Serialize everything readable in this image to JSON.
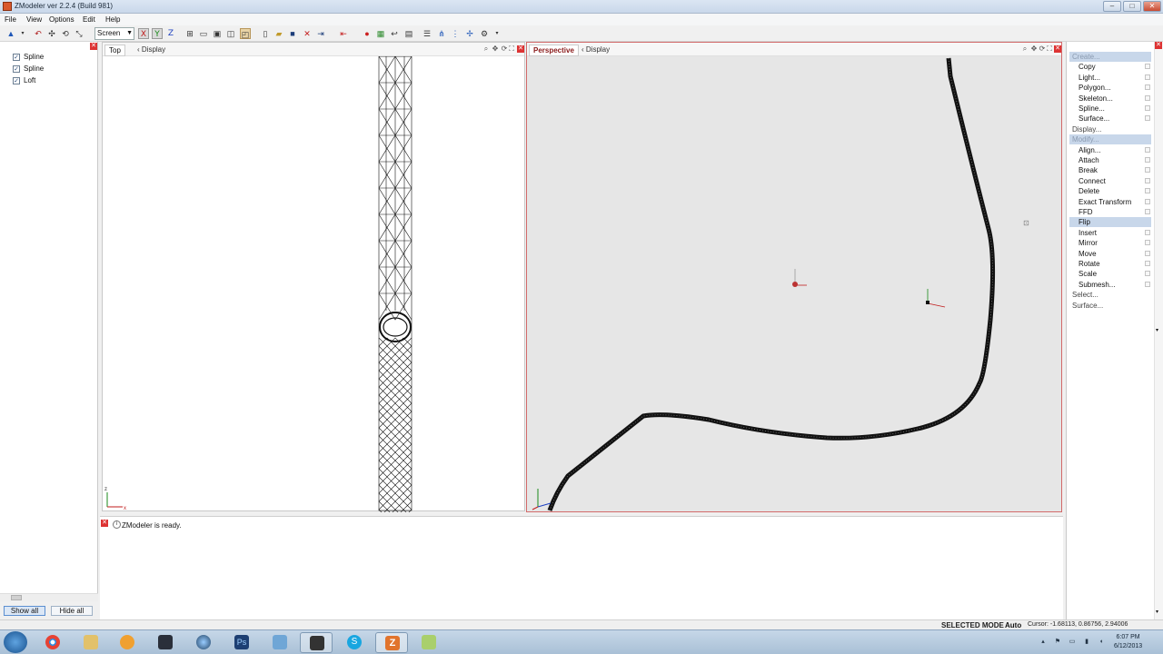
{
  "window": {
    "title": "ZModeler ver 2.2.4 (Build 981)"
  },
  "menu": [
    "File",
    "View",
    "Options",
    "Edit",
    "Help"
  ],
  "toolbar": {
    "view_mode": "Screen",
    "axes": [
      "X",
      "Y",
      "Z"
    ]
  },
  "tree": {
    "items": [
      {
        "label": "Spline",
        "checked": true
      },
      {
        "label": "Spline",
        "checked": true
      },
      {
        "label": "Loft",
        "checked": true
      }
    ],
    "show_all": "Show all",
    "hide_all": "Hide all"
  },
  "viewports": {
    "top": {
      "name": "Top",
      "display": "Display"
    },
    "perspective": {
      "name": "Perspective",
      "display": "Display"
    }
  },
  "log": {
    "message": "ZModeler is ready."
  },
  "commands": [
    {
      "label": "Create...",
      "kind": "category",
      "highlight": true,
      "disabled": true
    },
    {
      "label": "Copy",
      "kind": "item"
    },
    {
      "label": "Light...",
      "kind": "item"
    },
    {
      "label": "Polygon...",
      "kind": "item"
    },
    {
      "label": "Skeleton...",
      "kind": "item"
    },
    {
      "label": "Spline...",
      "kind": "item"
    },
    {
      "label": "Surface...",
      "kind": "item"
    },
    {
      "label": "Display...",
      "kind": "category"
    },
    {
      "label": "Modify...",
      "kind": "category",
      "highlight": true,
      "disabled": true
    },
    {
      "label": "Align...",
      "kind": "item"
    },
    {
      "label": "Attach",
      "kind": "item"
    },
    {
      "label": "Break",
      "kind": "item"
    },
    {
      "label": "Connect",
      "kind": "item"
    },
    {
      "label": "Delete",
      "kind": "item"
    },
    {
      "label": "Exact Transform",
      "kind": "item"
    },
    {
      "label": "FFD",
      "kind": "item"
    },
    {
      "label": "Flip",
      "kind": "item",
      "highlight": true
    },
    {
      "label": "Insert",
      "kind": "item"
    },
    {
      "label": "Mirror",
      "kind": "item"
    },
    {
      "label": "Move",
      "kind": "item"
    },
    {
      "label": "Rotate",
      "kind": "item"
    },
    {
      "label": "Scale",
      "kind": "item"
    },
    {
      "label": "Submesh...",
      "kind": "item"
    },
    {
      "label": "Select...",
      "kind": "category"
    },
    {
      "label": "Surface...",
      "kind": "category"
    }
  ],
  "status": {
    "mode": "SELECTED MODE",
    "auto": "Auto",
    "cursor": "Cursor: -1.68113, 0.86756, 2.94006"
  },
  "taskbar": {
    "time": "6:07 PM",
    "date": "6/12/2013"
  },
  "colors": {
    "selection": "#c8d7ea",
    "active_viewport": "#d26a6a",
    "close_button": "#dd3333"
  }
}
